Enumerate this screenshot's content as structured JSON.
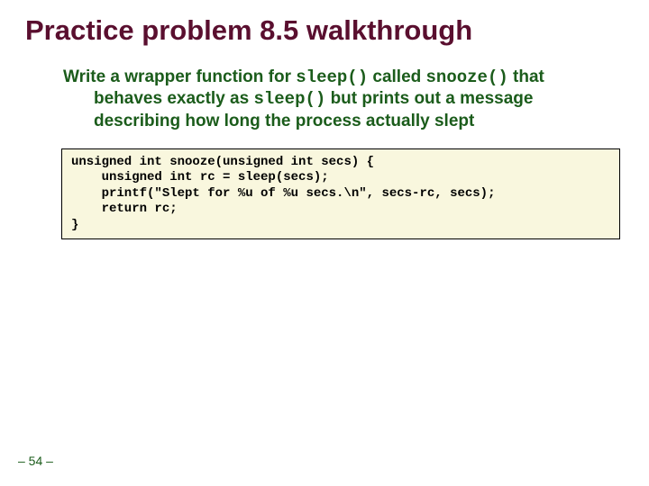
{
  "title": "Practice problem 8.5 walkthrough",
  "body": {
    "pre1": "Write a wrapper function for ",
    "code1": "sleep()",
    "mid1": " called ",
    "code2": "snooze()",
    "mid2": " that behaves exactly as ",
    "code3": "sleep()",
    "post": " but prints out a message describing how long the process actually slept"
  },
  "code": "unsigned int snooze(unsigned int secs) {\n    unsigned int rc = sleep(secs);\n    printf(\"Slept for %u of %u secs.\\n\", secs-rc, secs);\n    return rc;\n}",
  "pagenum": "– 54 –"
}
